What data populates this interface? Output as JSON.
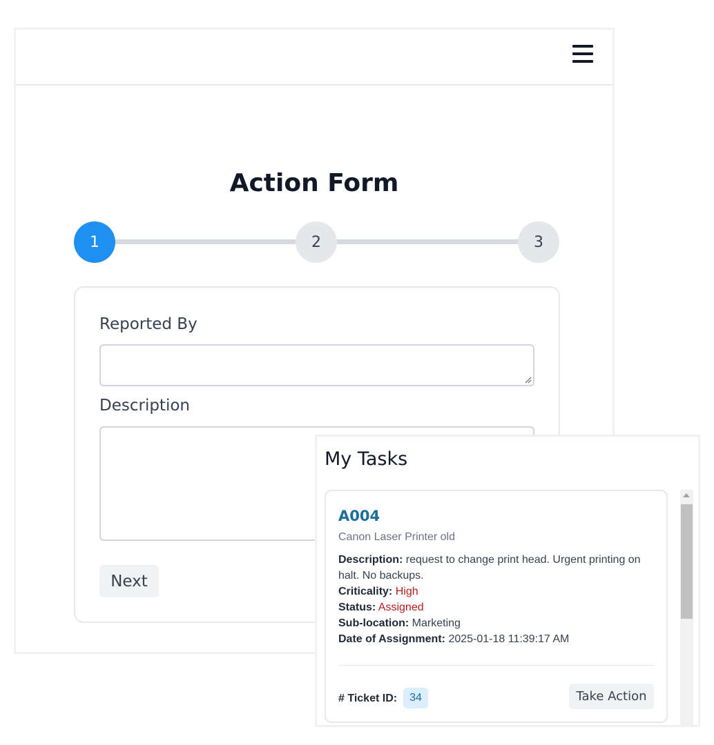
{
  "header": {
    "menu_icon": "hamburger-menu-icon"
  },
  "form": {
    "title": "Action Form",
    "steps": [
      {
        "label": "1",
        "state": "active"
      },
      {
        "label": "2",
        "state": "inactive"
      },
      {
        "label": "3",
        "state": "inactive"
      }
    ],
    "fields": {
      "reported_by": {
        "label": "Reported By",
        "value": ""
      },
      "description": {
        "label": "Description",
        "value": ""
      }
    },
    "next_label": "Next"
  },
  "tasks_panel": {
    "title": "My Tasks",
    "task": {
      "code": "A004",
      "asset": "Canon Laser Printer old",
      "description_label": "Description:",
      "description": "request to change print head. Urgent printing on halt. No backups.",
      "criticality_label": "Criticality:",
      "criticality": "High",
      "status_label": "Status:",
      "status": "Assigned",
      "sublocation_label": "Sub-location:",
      "sublocation": "Marketing",
      "date_label": "Date of Assignment:",
      "date": "2025-01-18 11:39:17 AM",
      "ticket_label": "# Ticket ID:",
      "ticket_id": "34",
      "action_label": "Take Action"
    }
  },
  "colors": {
    "accent": "#1d90f2",
    "link": "#1a6e9a",
    "danger": "#b91c1c"
  }
}
